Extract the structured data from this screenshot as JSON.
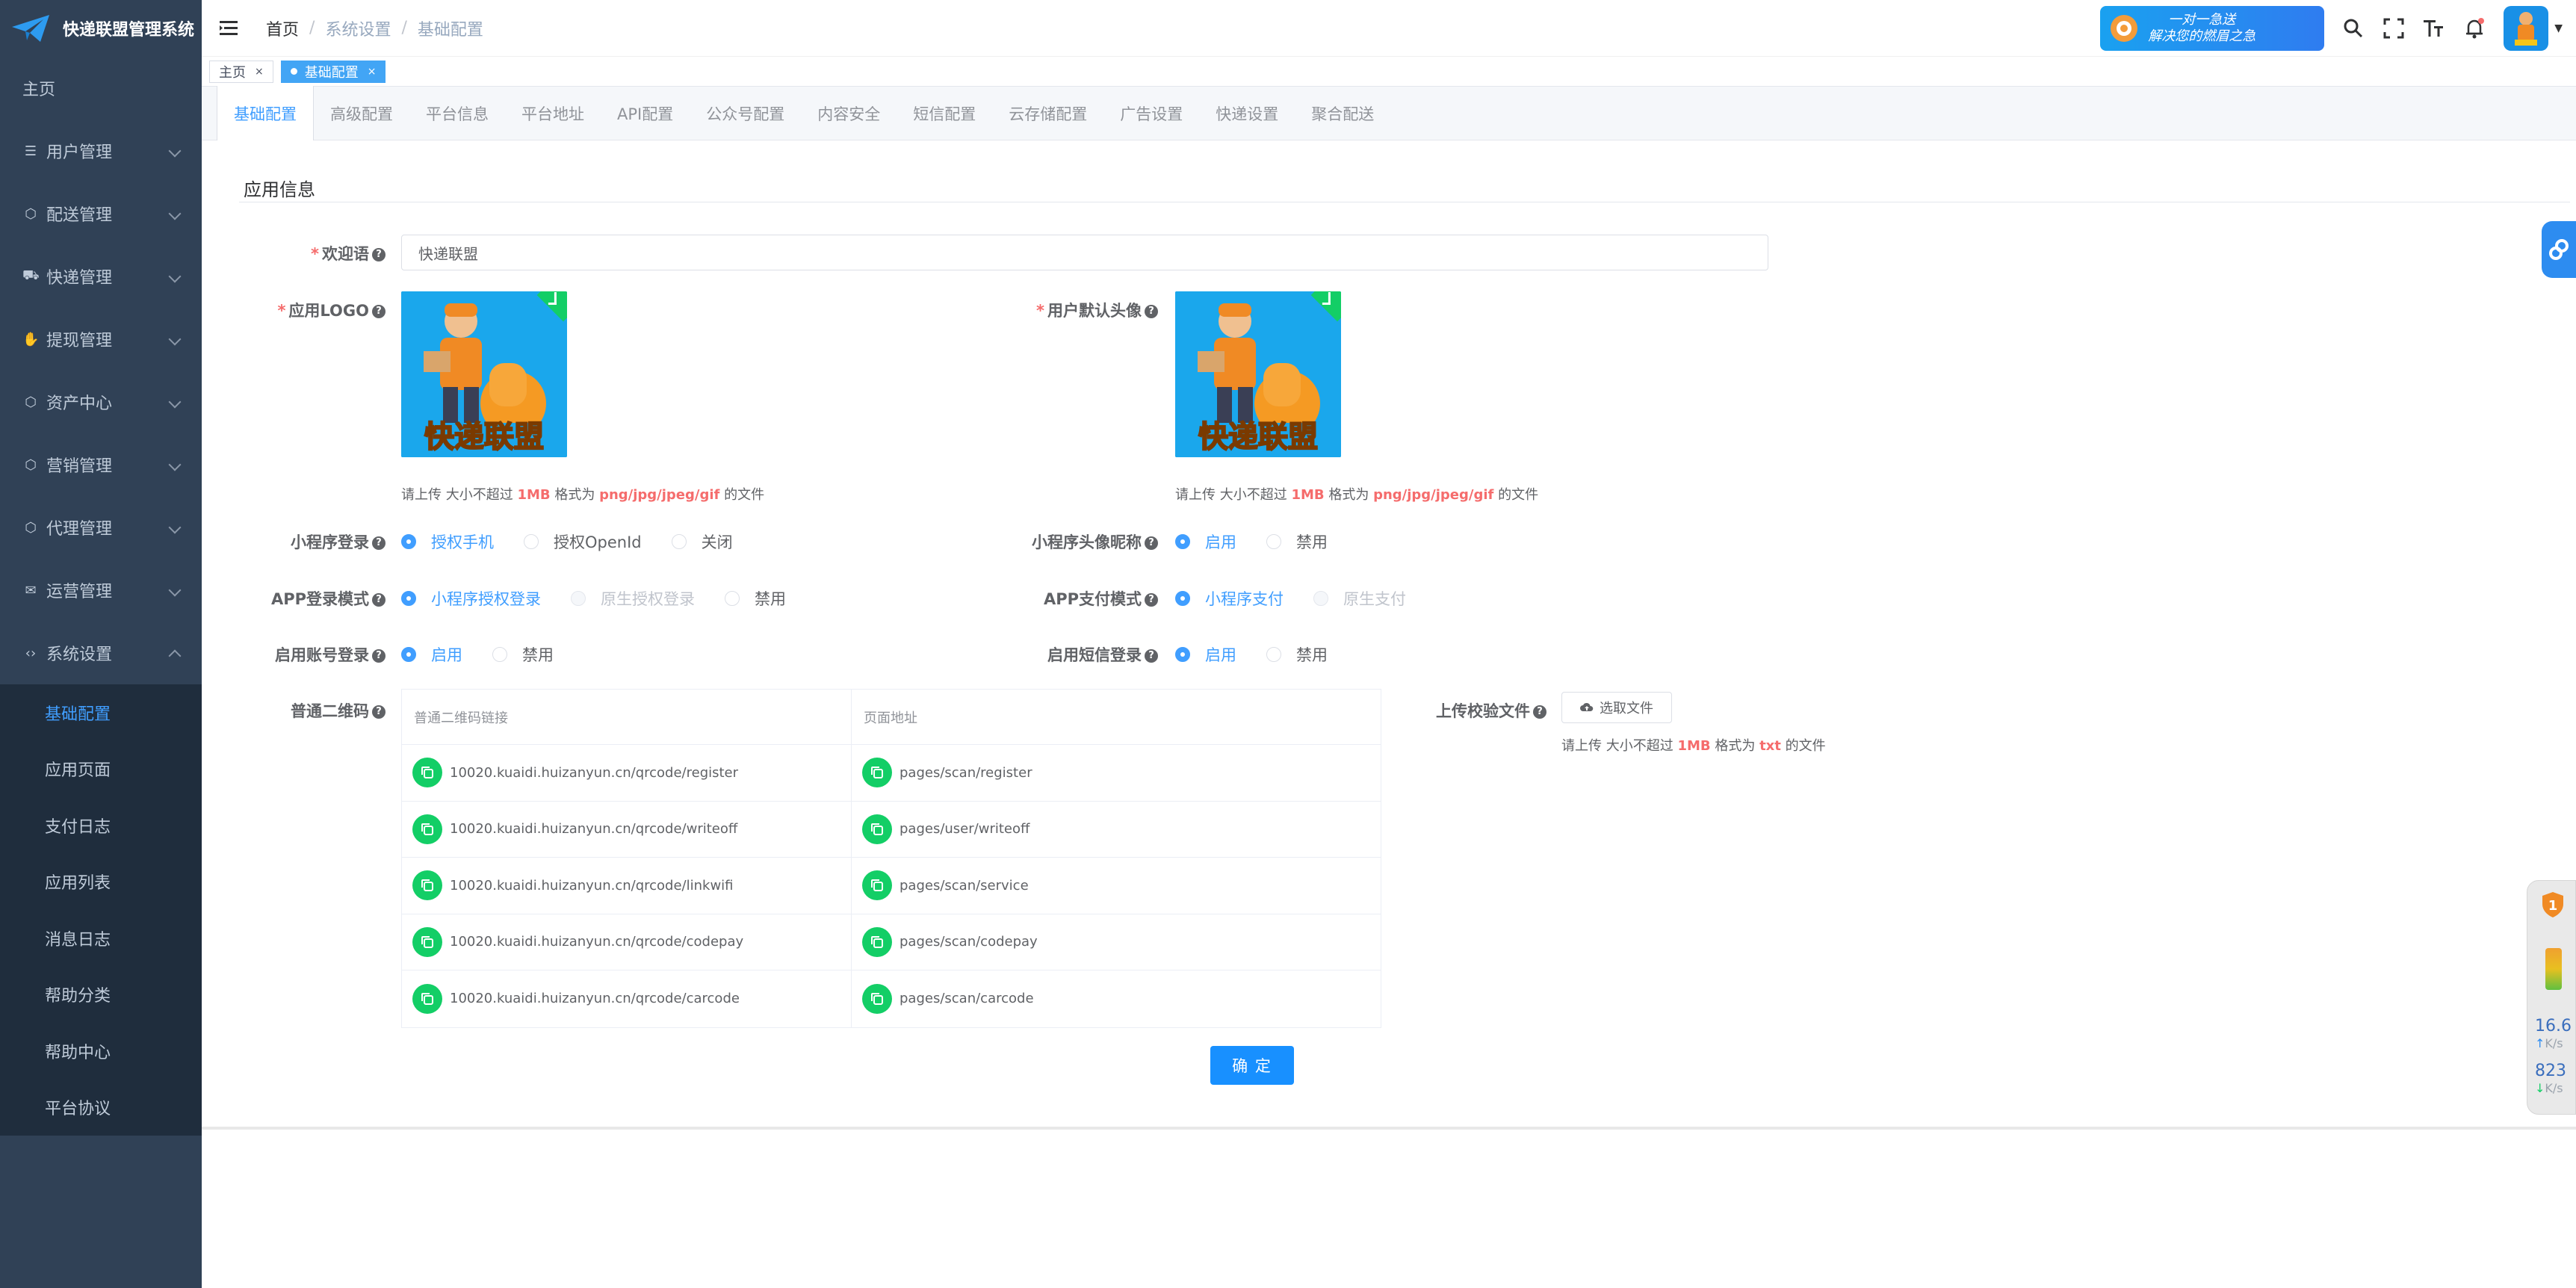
{
  "app": {
    "title": "快递联盟管理系统"
  },
  "sidebar": {
    "home": "主页",
    "items": [
      {
        "label": "用户管理",
        "icon": "list-icon"
      },
      {
        "label": "配送管理",
        "icon": "cube-icon"
      },
      {
        "label": "快递管理",
        "icon": "truck-icon"
      },
      {
        "label": "提现管理",
        "icon": "hand-icon"
      },
      {
        "label": "资产中心",
        "icon": "cube-icon"
      },
      {
        "label": "营销管理",
        "icon": "cube-icon"
      },
      {
        "label": "代理管理",
        "icon": "cube-icon"
      },
      {
        "label": "运营管理",
        "icon": "mail-icon"
      },
      {
        "label": "系统设置",
        "icon": "code-icon"
      }
    ],
    "sub_items": [
      "基础配置",
      "应用页面",
      "支付日志",
      "应用列表",
      "消息日志",
      "帮助分类",
      "帮助中心",
      "平台协议"
    ]
  },
  "header": {
    "breadcrumb": [
      "首页",
      "系统设置",
      "基础配置"
    ],
    "banner_line1": "一对一急送",
    "banner_line2": "解决您的燃眉之急"
  },
  "tags": {
    "home": "主页",
    "active": "基础配置",
    "close": "×"
  },
  "tabs": [
    "基础配置",
    "高级配置",
    "平台信息",
    "平台地址",
    "API配置",
    "公众号配置",
    "内容安全",
    "短信配置",
    "云存储配置",
    "广告设置",
    "快递设置",
    "聚合配送"
  ],
  "form": {
    "section_title": "应用信息",
    "welcome_label": "欢迎语",
    "welcome_value": "快递联盟",
    "logo_label": "应用LOGO",
    "avatar_label": "用户默认头像",
    "upload_tip": {
      "prefix": "请上传 大小不超过 ",
      "size": "1MB",
      "mid": " 格式为 ",
      "formats": "png/jpg/jpeg/gif",
      "suffix": " 的文件"
    },
    "upload_logo_text": "快递联盟",
    "mini_login": {
      "label": "小程序登录",
      "options": [
        "授权手机",
        "授权OpenId",
        "关闭"
      ]
    },
    "mini_avatar_nick": {
      "label": "小程序头像昵称",
      "options": [
        "启用",
        "禁用"
      ]
    },
    "app_login": {
      "label": "APP登录模式",
      "options": [
        "小程序授权登录",
        "原生授权登录",
        "禁用"
      ]
    },
    "app_pay": {
      "label": "APP支付模式",
      "options": [
        "小程序支付",
        "原生支付"
      ]
    },
    "account_login": {
      "label": "启用账号登录",
      "options": [
        "启用",
        "禁用"
      ]
    },
    "sms_login": {
      "label": "启用短信登录",
      "options": [
        "启用",
        "禁用"
      ]
    },
    "qrcode_label": "普通二维码",
    "qrcode_table": {
      "headers": [
        "普通二维码链接",
        "页面地址"
      ],
      "rows": [
        [
          "10020.kuaidi.huizanyun.cn/qrcode/register",
          "pages/scan/register"
        ],
        [
          "10020.kuaidi.huizanyun.cn/qrcode/writeoff",
          "pages/user/writeoff"
        ],
        [
          "10020.kuaidi.huizanyun.cn/qrcode/linkwifi",
          "pages/scan/service"
        ],
        [
          "10020.kuaidi.huizanyun.cn/qrcode/codepay",
          "pages/scan/codepay"
        ],
        [
          "10020.kuaidi.huizanyun.cn/qrcode/carcode",
          "pages/scan/carcode"
        ]
      ]
    },
    "verify_file_label": "上传校验文件",
    "select_file": "选取文件",
    "verify_tip": {
      "prefix": "请上传 大小不超过 ",
      "size": "1MB",
      "mid": " 格式为 ",
      "formats": "txt",
      "suffix": " 的文件"
    },
    "submit": "确 定"
  },
  "speed_widget": {
    "shield_num": "1",
    "up_value": "16.6",
    "up_unit": "K/s",
    "down_value": "823",
    "down_unit": "K/s"
  },
  "colors": {
    "sidebar_bg": "#304156",
    "submenu_bg": "#1f2d3d",
    "primary": "#409eff",
    "required": "#f56c6c",
    "success": "#13ce66"
  }
}
